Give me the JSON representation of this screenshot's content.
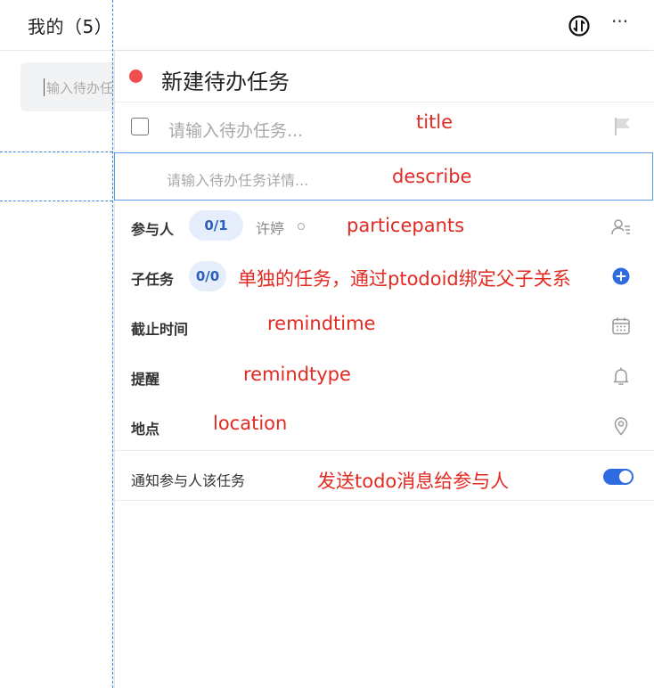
{
  "list": {
    "title": "我的（5）",
    "input_placeholder": "输入待办任"
  },
  "header": {
    "sort_icon": "sort-toggle-icon",
    "more_icon": "more-ellipsis-icon",
    "more_label": "···"
  },
  "panel": {
    "title": "新建待办任务",
    "title_placeholder": "请输入待办任务...",
    "description_placeholder": "请输入待办任务详情...",
    "participants_label": "参与人",
    "participants_count": "0/1",
    "participant_name": "许婷",
    "subtasks_label": "子任务",
    "subtasks_count": "0/0",
    "deadline_label": "截止时间",
    "reminder_label": "提醒",
    "location_label": "地点",
    "notify_label": "通知参与人该任务",
    "notify_enabled": true
  },
  "annotations": {
    "title": "title",
    "describe": "describe",
    "participants": "particepants",
    "subtasks": "单独的任务，通过ptodoid绑定父子关系",
    "remindtime": "remindtime",
    "remindtype": "remindtype",
    "location": "location",
    "notify": "发送todo消息给参与人"
  },
  "colors": {
    "accent": "#2f6be0",
    "annotation": "#e22a22",
    "status_dot": "#ee4e4e"
  }
}
